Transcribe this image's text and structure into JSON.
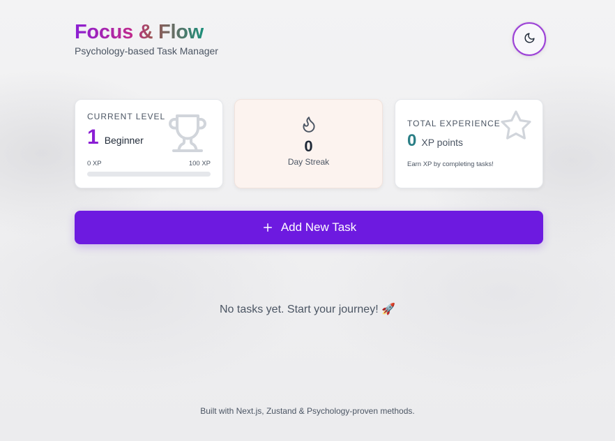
{
  "app": {
    "title": "Focus & Flow",
    "tagline": "Psychology-based Task Manager"
  },
  "theme_toggle": {
    "icon": "moon-icon"
  },
  "level_card": {
    "label": "CURRENT LEVEL",
    "level": "1",
    "level_name": "Beginner",
    "xp_min": "0 XP",
    "xp_max": "100 XP",
    "progress_fraction": 0,
    "icon": "trophy-icon"
  },
  "streak_card": {
    "value": "0",
    "label": "Day Streak",
    "icon": "flame-icon"
  },
  "xp_card": {
    "label": "TOTAL EXPERIENCE",
    "value": "0",
    "unit": "XP points",
    "hint": "Earn XP by completing tasks!",
    "icon": "star-icon"
  },
  "add_task": {
    "label": "Add New Task",
    "icon": "plus-icon"
  },
  "empty_state": {
    "message": "No tasks yet. Start your journey! 🚀"
  },
  "footer": {
    "text": "Built with Next.js, Zustand & Psychology-proven methods."
  },
  "colors": {
    "primary": "#6d1ae0",
    "level_accent": "#8b1fd4",
    "xp_accent": "#2b7f86",
    "streak_bg": "#fcf3ef"
  }
}
